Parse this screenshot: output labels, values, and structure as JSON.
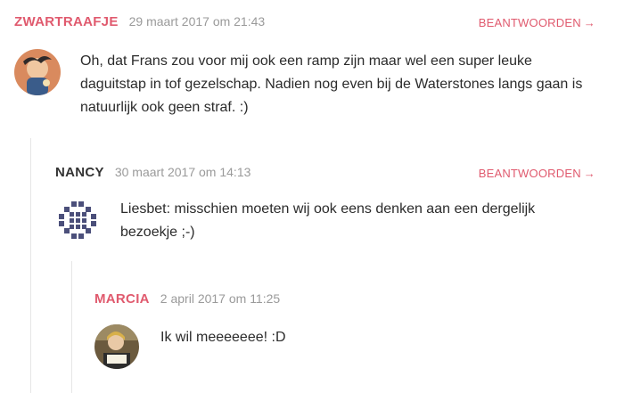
{
  "comments": [
    {
      "author": "ZWARTRAAFJE",
      "date": "29 maart 2017 om 21:43",
      "reply_label": "BEANTWOORDEN",
      "reply_arrow": "→",
      "text": "Oh, dat Frans zou voor mij ook een ramp zijn maar wel een super leuke daguitstap in tof gezelschap. Nadien nog even bij de Waterstones langs gaan is natuurlijk ook geen straf. :)",
      "author_color": "#e05a6e"
    },
    {
      "author": "NANCY",
      "date": "30 maart 2017 om 14:13",
      "reply_label": "BEANTWOORDEN",
      "reply_arrow": "→",
      "text": "Liesbet: misschien moeten wij ook eens denken aan een dergelijk bezoekje ;-)",
      "author_color": "#333333"
    },
    {
      "author": "MARCIA",
      "date": "2 april 2017 om 11:25",
      "text": "Ik wil meeeeeee! :D",
      "author_color": "#e05a6e"
    }
  ],
  "colors": {
    "accent": "#e05a6e",
    "date": "#9a9a9a",
    "thread_line": "#e6e6e6"
  }
}
